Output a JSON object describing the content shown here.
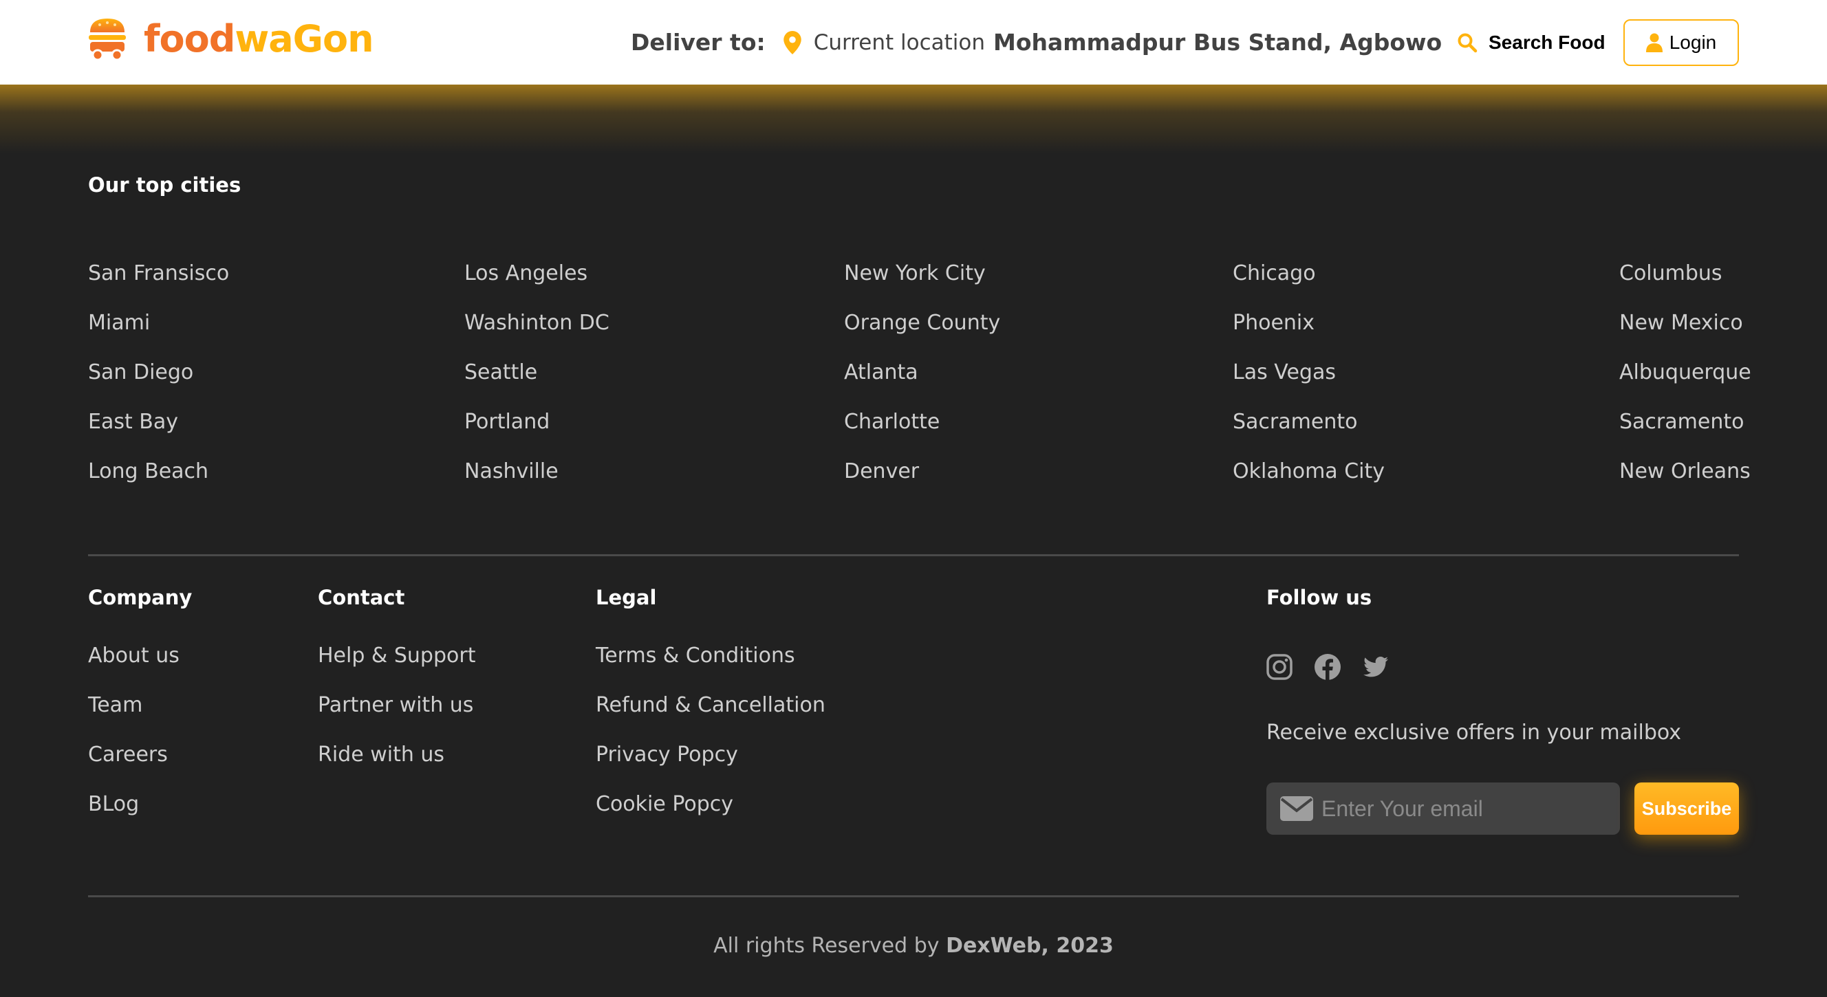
{
  "brand": {
    "name_part1": "food",
    "name_part2": "waGon",
    "colors": {
      "orange": "#f17228",
      "yellow": "#ffb30e",
      "background": "#212121"
    }
  },
  "header": {
    "deliver_label": "Deliver to:",
    "current_location_label": "Current location",
    "address": "Mohammadpur Bus Stand, Agbowo",
    "search_label": "Search Food",
    "login_label": "Login",
    "icons": {
      "location": "map-pin-icon",
      "search": "search-icon",
      "user": "user-icon"
    }
  },
  "top_cities": {
    "title": "Our top cities",
    "columns": [
      [
        "San Fransisco",
        "Miami",
        "San Diego",
        "East Bay",
        "Long Beach"
      ],
      [
        "Los Angeles",
        "Washinton DC",
        "Seattle",
        "Portland",
        "Nashville"
      ],
      [
        "New York City",
        "Orange County",
        "Atlanta",
        "Charlotte",
        "Denver"
      ],
      [
        "Chicago",
        "Phoenix",
        "Las Vegas",
        "Sacramento",
        "Oklahoma City"
      ],
      [
        "Columbus",
        "New Mexico",
        "Albuquerque",
        "Sacramento",
        "New Orleans"
      ]
    ]
  },
  "footer": {
    "company": {
      "title": "Company",
      "links": [
        "About us",
        "Team",
        "Careers",
        "BLog"
      ]
    },
    "contact": {
      "title": "Contact",
      "links": [
        "Help & Support",
        "Partner with us",
        "Ride with us"
      ]
    },
    "legal": {
      "title": "Legal",
      "links": [
        "Terms & Conditions",
        "Refund & Cancellation",
        "Privacy Popcy",
        "Cookie Popcy"
      ]
    },
    "follow": {
      "title": "Follow us",
      "social": [
        "instagram-icon",
        "facebook-icon",
        "twitter-icon"
      ],
      "offers_text": "Receive exclusive offers in your mailbox",
      "email_placeholder": "Enter Your email",
      "subscribe_label": "Subscribe"
    },
    "copyright_prefix": "All rights Reserved by",
    "copyright_owner": "DexWeb, 2023"
  }
}
